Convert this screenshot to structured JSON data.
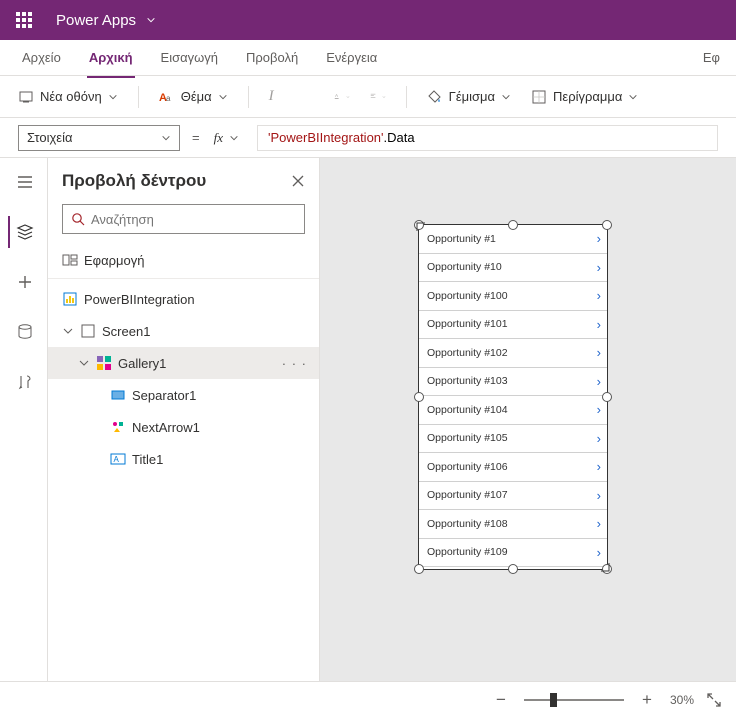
{
  "app": {
    "title": "Power Apps"
  },
  "menu": {
    "file": "Αρχείο",
    "home": "Αρχική",
    "insert": "Εισαγωγή",
    "view": "Προβολή",
    "action": "Ενέργεια",
    "right_partial": "Εφ"
  },
  "ribbon": {
    "new_screen": "Νέα οθόνη",
    "theme": "Θέμα",
    "fill": "Γέμισμα",
    "border": "Περίγραμμα"
  },
  "formula": {
    "property": "Στοιχεία",
    "equals": "=",
    "fx_label": "fx",
    "literal": "'PowerBIIntegration'",
    "dot": ".",
    "prop": "Data"
  },
  "tree": {
    "title": "Προβολή δέντρου",
    "search_placeholder": "Αναζήτηση",
    "app_row": "Εφαρμογή",
    "pbi_row": "PowerBIIntegration",
    "screen_row": "Screen1",
    "gallery_row": "Gallery1",
    "separator_row": "Separator1",
    "nextarrow_row": "NextArrow1",
    "title_row": "Title1",
    "more": "· · ·"
  },
  "gallery_items": [
    "Opportunity #1",
    "Opportunity #10",
    "Opportunity #100",
    "Opportunity #101",
    "Opportunity #102",
    "Opportunity #103",
    "Opportunity #104",
    "Opportunity #105",
    "Opportunity #106",
    "Opportunity #107",
    "Opportunity #108",
    "Opportunity #109"
  ],
  "status": {
    "zoom": "30%"
  }
}
